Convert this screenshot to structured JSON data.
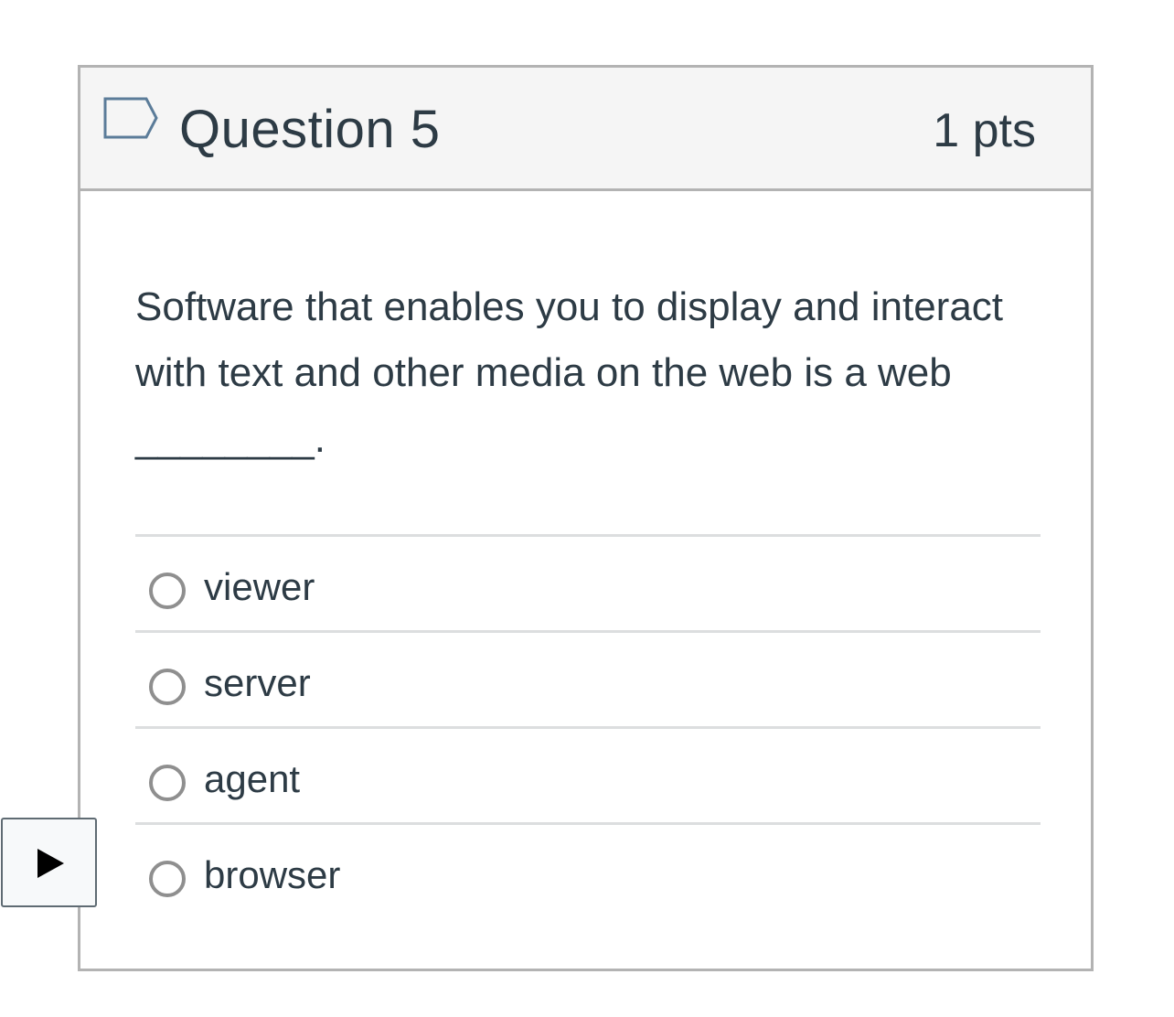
{
  "question": {
    "title": "Question 5",
    "points": "1 pts",
    "flag_icon": "flag-outline-icon",
    "text": "Software that enables you to display and interact with text and other media on the web is a web ________."
  },
  "answers": [
    {
      "label": "viewer",
      "selected": false
    },
    {
      "label": "server",
      "selected": false
    },
    {
      "label": "agent",
      "selected": false
    },
    {
      "label": "browser",
      "selected": false
    }
  ],
  "media": {
    "play_icon": "play-icon"
  },
  "colors": {
    "text": "#2d3b45",
    "header_background": "#f5f5f5",
    "border": "#b3b3b3",
    "divider": "#dcdedf",
    "radio_border": "#8f8f8f",
    "flag_stroke": "#5b7c99"
  }
}
